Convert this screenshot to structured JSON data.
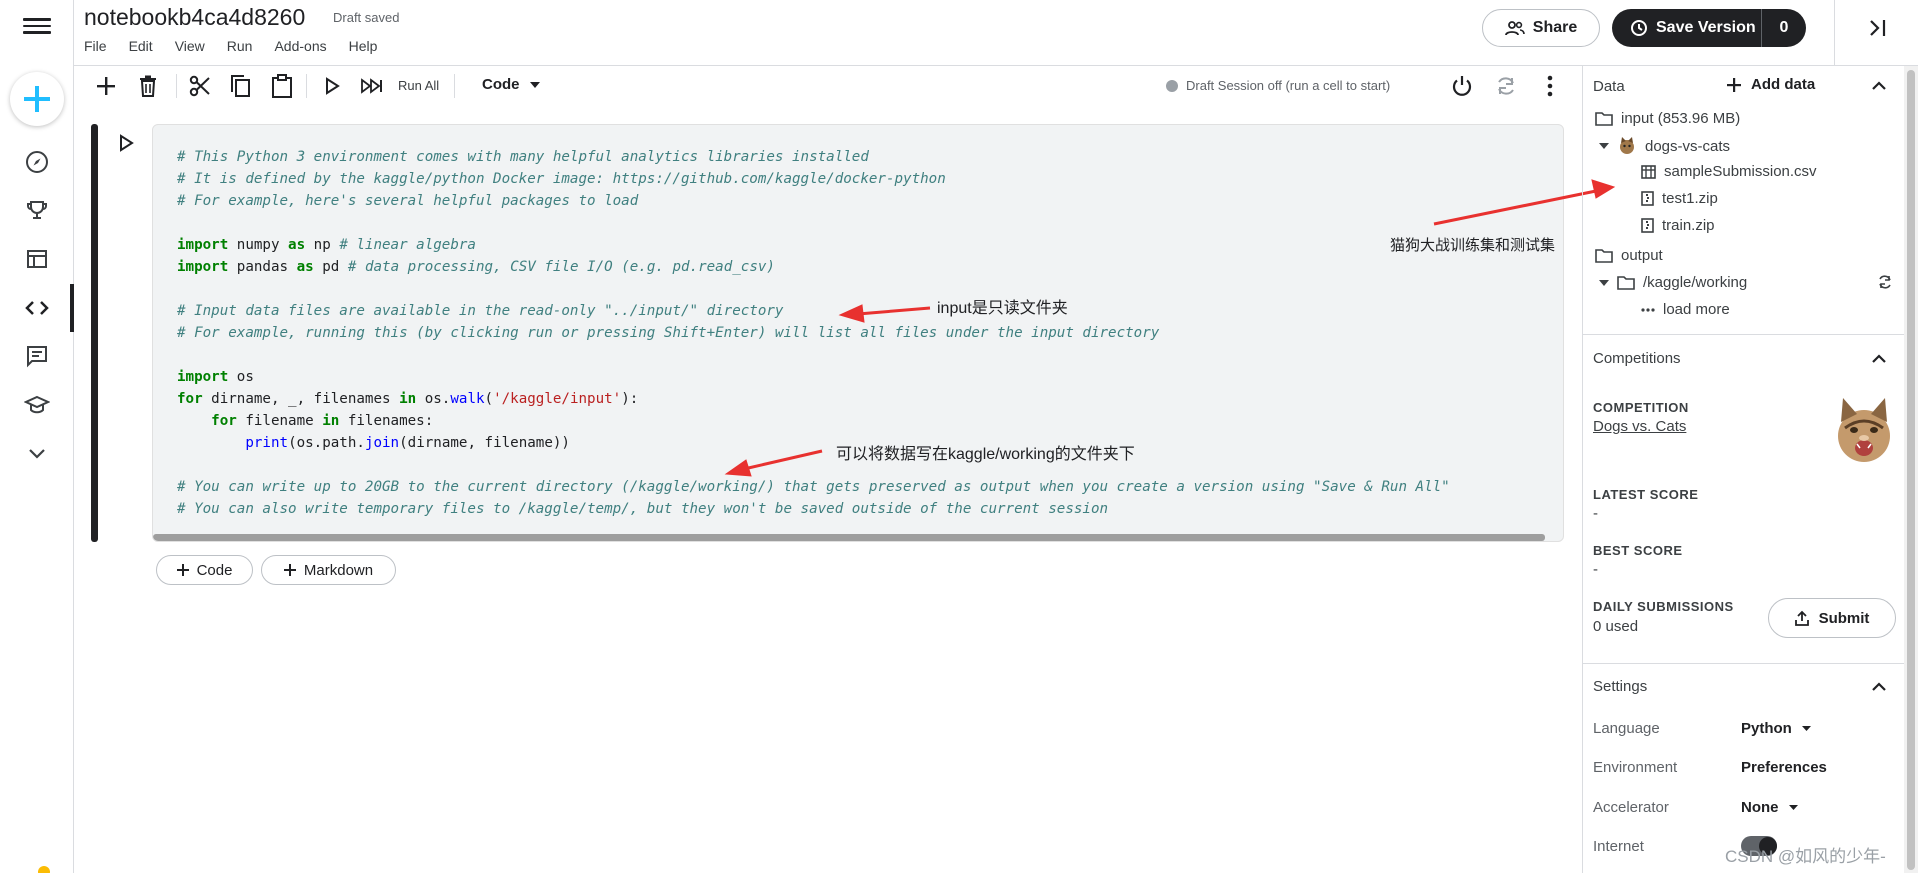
{
  "notebook": {
    "title": "notebookb4ca4d8260",
    "status": "Draft saved"
  },
  "menus": [
    "File",
    "Edit",
    "View",
    "Run",
    "Add-ons",
    "Help"
  ],
  "header": {
    "share_label": "Share",
    "save_label": "Save Version",
    "save_count": "0"
  },
  "toolbar": {
    "run_all_label": "Run All",
    "cell_type": "Code",
    "session_status": "Draft Session off (run a cell to start)"
  },
  "cell": {
    "lines": [
      [
        {
          "c": "cm",
          "t": "# This Python 3 environment comes with many helpful analytics libraries installed"
        }
      ],
      [
        {
          "c": "cm",
          "t": "# It is defined by the kaggle/python Docker image: https://github.com/kaggle/docker-python"
        }
      ],
      [
        {
          "c": "cm",
          "t": "# For example, here's several helpful packages to load"
        }
      ],
      [],
      [
        {
          "c": "kw",
          "t": "import"
        },
        {
          "c": "",
          "t": " numpy "
        },
        {
          "c": "kw",
          "t": "as"
        },
        {
          "c": "",
          "t": " np "
        },
        {
          "c": "cm",
          "t": "# linear algebra"
        }
      ],
      [
        {
          "c": "kw",
          "t": "import"
        },
        {
          "c": "",
          "t": " pandas "
        },
        {
          "c": "kw",
          "t": "as"
        },
        {
          "c": "",
          "t": " pd "
        },
        {
          "c": "cm",
          "t": "# data processing, CSV file I/O (e.g. pd.read_csv)"
        }
      ],
      [],
      [
        {
          "c": "cm",
          "t": "# Input data files are available in the read-only \"../input/\" directory"
        }
      ],
      [
        {
          "c": "cm",
          "t": "# For example, running this (by clicking run or pressing Shift+Enter) will list all files under the input directory"
        }
      ],
      [],
      [
        {
          "c": "kw",
          "t": "import"
        },
        {
          "c": "",
          "t": " os"
        }
      ],
      [
        {
          "c": "kw",
          "t": "for"
        },
        {
          "c": "",
          "t": " dirname, _, filenames "
        },
        {
          "c": "kw",
          "t": "in"
        },
        {
          "c": "",
          "t": " os."
        },
        {
          "c": "fn",
          "t": "walk"
        },
        {
          "c": "",
          "t": "("
        },
        {
          "c": "st",
          "t": "'/kaggle/input'"
        },
        {
          "c": "",
          "t": "):"
        }
      ],
      [
        {
          "c": "",
          "t": "    "
        },
        {
          "c": "kw",
          "t": "for"
        },
        {
          "c": "",
          "t": " filename "
        },
        {
          "c": "kw",
          "t": "in"
        },
        {
          "c": "",
          "t": " filenames:"
        }
      ],
      [
        {
          "c": "",
          "t": "        "
        },
        {
          "c": "fn",
          "t": "print"
        },
        {
          "c": "",
          "t": "(os.path."
        },
        {
          "c": "fn",
          "t": "join"
        },
        {
          "c": "",
          "t": "(dirname, filename))"
        }
      ],
      [],
      [
        {
          "c": "cm",
          "t": "# You can write up to 20GB to the current directory (/kaggle/working/) that gets preserved as output when you create a version using \"Save & Run All\""
        }
      ],
      [
        {
          "c": "cm",
          "t": "# You can also write temporary files to /kaggle/temp/, but they won't be saved outside of the current session"
        }
      ]
    ]
  },
  "add_cell": {
    "code_label": "Code",
    "markdown_label": "Markdown"
  },
  "annotations": {
    "input_readonly": "input是只读文件夹",
    "working_dir": "可以将数据写在kaggle/working的文件夹下",
    "dataset": "猫狗大战训练集和测试集"
  },
  "data_panel": {
    "title": "Data",
    "add_data_label": "Add data",
    "input_label": "input (853.96 MB)",
    "dataset_name": "dogs-vs-cats",
    "files": [
      "sampleSubmission.csv",
      "test1.zip",
      "train.zip"
    ],
    "output_label": "output",
    "working_label": "/kaggle/working",
    "load_more": "load more"
  },
  "competitions": {
    "title": "Competitions",
    "competition_caption": "COMPETITION",
    "competition_name": "Dogs vs. Cats",
    "latest_score_caption": "LATEST SCORE",
    "latest_score": "-",
    "best_score_caption": "BEST SCORE",
    "best_score": "-",
    "daily_caption": "DAILY SUBMISSIONS",
    "daily_used": "0 used",
    "submit_label": "Submit"
  },
  "settings": {
    "title": "Settings",
    "rows": [
      {
        "label": "Language",
        "value": "Python",
        "dropdown": true
      },
      {
        "label": "Environment",
        "value": "Preferences",
        "dropdown": false
      },
      {
        "label": "Accelerator",
        "value": "None",
        "dropdown": true
      },
      {
        "label": "Internet",
        "value": "",
        "dropdown": false
      }
    ]
  },
  "watermark": "CSDN @如风的少年-",
  "colors": {
    "accent_blue": "#20beff",
    "dark": "#202124",
    "arrow_red": "#e8312f"
  }
}
